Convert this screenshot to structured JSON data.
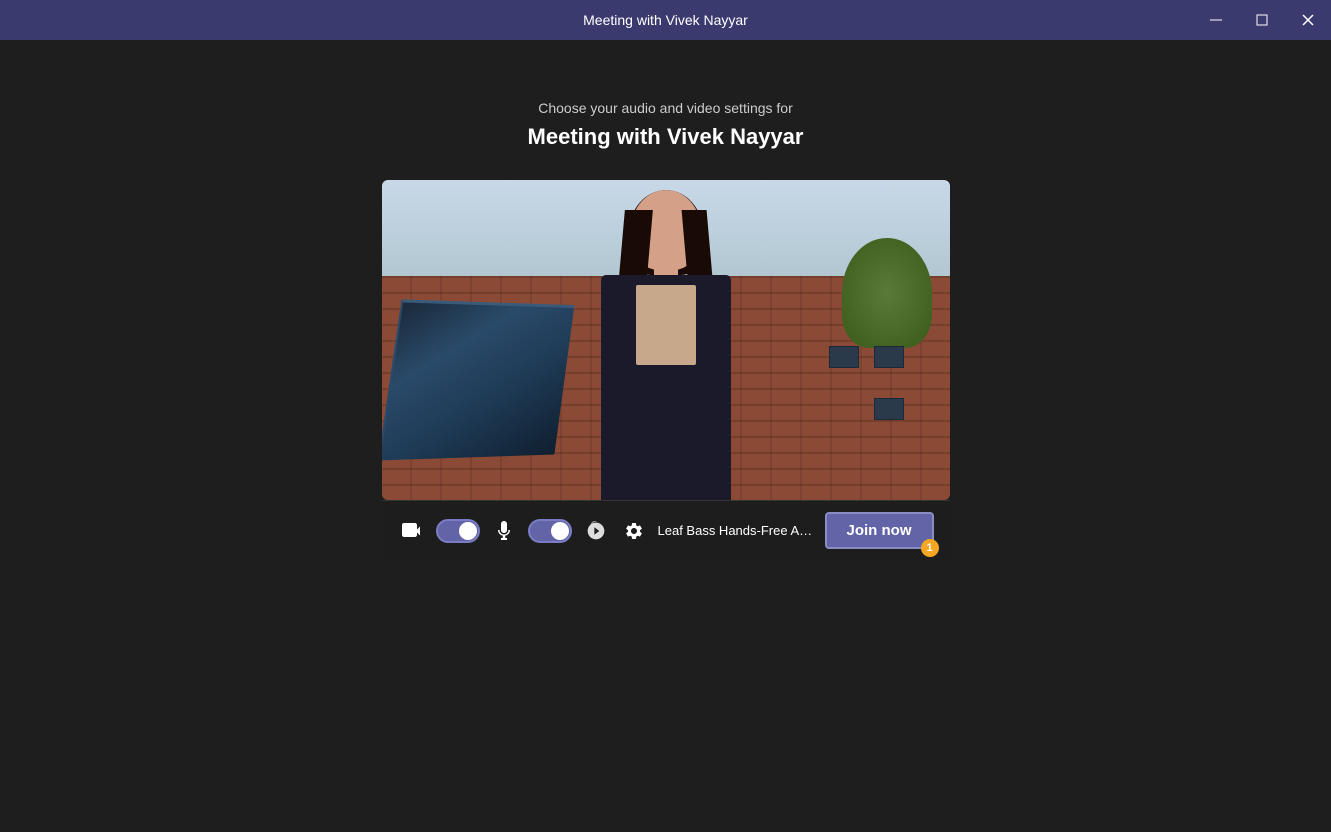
{
  "titlebar": {
    "title": "Meeting with Vivek Nayyar",
    "minimize_label": "minimize",
    "maximize_label": "maximize",
    "close_label": "close"
  },
  "header": {
    "subtitle": "Choose your audio and video settings for",
    "meeting_title": "Meeting with Vivek Nayyar"
  },
  "controls": {
    "video_toggle": "on",
    "audio_toggle": "on",
    "device_label": "Leaf Bass Hands-Free AG Au...",
    "join_now_label": "Join now",
    "notification_count": "1"
  },
  "icons": {
    "camera": "📷",
    "mic": "🎤",
    "noise": "🔊",
    "settings": "⚙"
  }
}
